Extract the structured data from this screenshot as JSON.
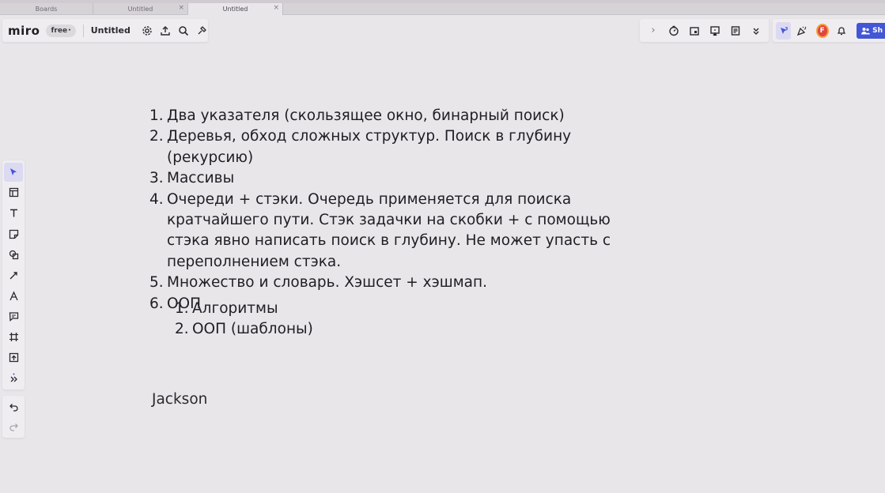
{
  "browser_tabs": [
    {
      "label": "Boards",
      "active": false,
      "closable": false
    },
    {
      "label": "Untitled",
      "active": false,
      "closable": true
    },
    {
      "label": "Untitled",
      "active": true,
      "closable": true
    }
  ],
  "boardbar": {
    "logo": "miro",
    "plan_badge": "free",
    "board_title": "Untitled",
    "icons": [
      "settings-icon",
      "upload-icon",
      "search-icon",
      "apps-icon"
    ]
  },
  "rightbar": {
    "collapse_icon": "chevron-right-icon",
    "tools": [
      "timer-icon",
      "board-card-icon",
      "present-icon",
      "notes-icon",
      "more-icon"
    ],
    "collab": [
      "cursor-icon",
      "celebrate-icon"
    ],
    "avatar_initial": "F",
    "bell_icon": "bell-icon",
    "share_label": "Sh"
  },
  "lefttools": {
    "items": [
      "select-icon",
      "templates-icon",
      "text-icon",
      "sticky-note-icon",
      "shapes-icon",
      "connection-line-icon",
      "pen-icon",
      "comment-icon",
      "frame-icon",
      "upload-icon",
      "more-tools-icon"
    ]
  },
  "undo": {
    "undo_icon": "undo-icon",
    "redo_icon": "redo-icon"
  },
  "canvas": {
    "main_list": [
      {
        "num": "1.",
        "text": "Два указателя (скользящее окно, бинарный поиск)"
      },
      {
        "num": "2.",
        "text": "Деревья, обход сложных структур. Поиск в глубину (рекурсию)"
      },
      {
        "num": "3.",
        "text": "Массивы"
      },
      {
        "num": "4.",
        "text": "Очереди + стэки. Очередь применяется для поиска кратчайшего пути. Стэк задачки на скобки + с помощью стэка явно написать поиск в глубину. Не может упасть с переполнением стэка."
      },
      {
        "num": "5.",
        "text": "Множество и словарь. Хэшсет + хэшмап."
      },
      {
        "num": "6.",
        "text": "ООП"
      }
    ],
    "sub_list": [
      {
        "num": "1.",
        "text": "Алгоритмы"
      },
      {
        "num": "2.",
        "text": "ООП (шаблоны)"
      }
    ],
    "name_note": "Jackson"
  }
}
